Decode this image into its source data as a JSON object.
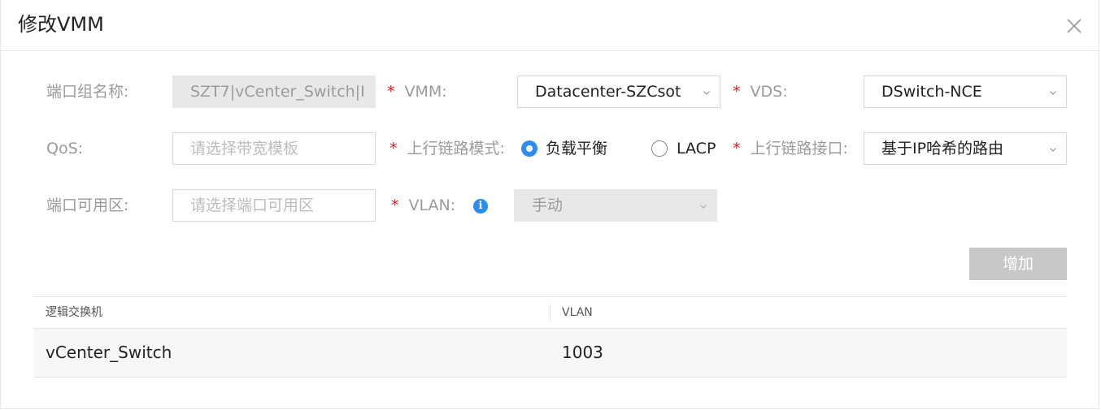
{
  "dialog": {
    "title": "修改VMM"
  },
  "form": {
    "port_group_name": {
      "label": "端口组名称:",
      "value": "SZT7|vCenter_Switch|I"
    },
    "vmm": {
      "required": "*",
      "label": "VMM:",
      "value": "Datacenter-SZCsot"
    },
    "vds": {
      "required": "*",
      "label": "VDS:",
      "value": "DSwitch-NCE"
    },
    "qos": {
      "label": "QoS:",
      "placeholder": "请选择带宽模板"
    },
    "uplink_mode": {
      "required": "*",
      "label": "上行链路模式:",
      "options": [
        {
          "label": "负载平衡",
          "checked": true
        },
        {
          "label": "LACP",
          "checked": false
        }
      ]
    },
    "uplink_port": {
      "required": "*",
      "label": "上行链路接口:",
      "value": "基于IP哈希的路由"
    },
    "port_zone": {
      "label": "端口可用区:",
      "placeholder": "请选择端口可用区"
    },
    "vlan": {
      "required": "*",
      "label": "VLAN:",
      "info_icon": "i",
      "value": "手动"
    }
  },
  "actions": {
    "add_label": "增加"
  },
  "table": {
    "columns": [
      "逻辑交换机",
      "VLAN"
    ],
    "rows": [
      [
        "vCenter_Switch",
        "1003"
      ]
    ]
  },
  "colors": {
    "accent": "#2d8cf0",
    "required": "#e02020",
    "disabled_button": "#c8c8c8"
  },
  "icons": {
    "close": "close-icon",
    "dropdown": "chevron-down-icon",
    "info": "info-icon"
  }
}
